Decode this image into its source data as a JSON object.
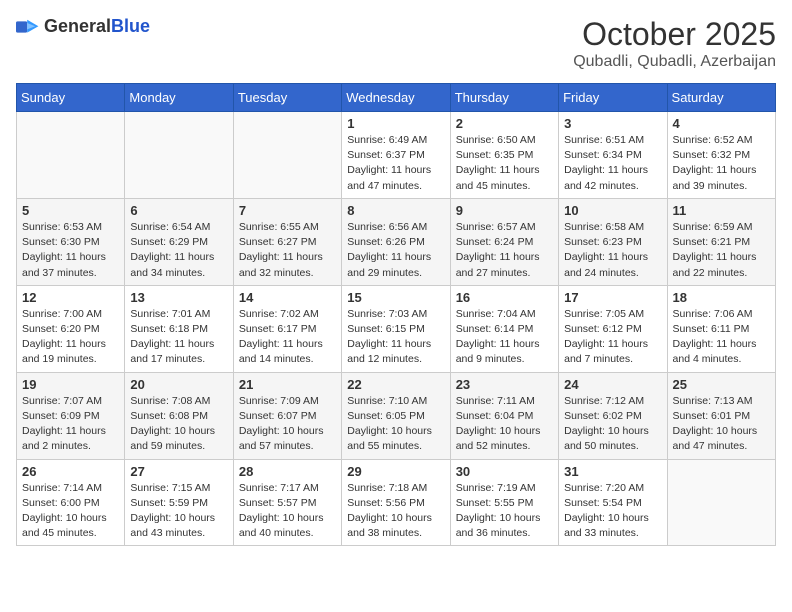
{
  "header": {
    "logo_general": "General",
    "logo_blue": "Blue",
    "month": "October 2025",
    "location": "Qubadli, Qubadli, Azerbaijan"
  },
  "days_of_week": [
    "Sunday",
    "Monday",
    "Tuesday",
    "Wednesday",
    "Thursday",
    "Friday",
    "Saturday"
  ],
  "weeks": [
    [
      {
        "day": "",
        "info": ""
      },
      {
        "day": "",
        "info": ""
      },
      {
        "day": "",
        "info": ""
      },
      {
        "day": "1",
        "info": "Sunrise: 6:49 AM\nSunset: 6:37 PM\nDaylight: 11 hours and 47 minutes."
      },
      {
        "day": "2",
        "info": "Sunrise: 6:50 AM\nSunset: 6:35 PM\nDaylight: 11 hours and 45 minutes."
      },
      {
        "day": "3",
        "info": "Sunrise: 6:51 AM\nSunset: 6:34 PM\nDaylight: 11 hours and 42 minutes."
      },
      {
        "day": "4",
        "info": "Sunrise: 6:52 AM\nSunset: 6:32 PM\nDaylight: 11 hours and 39 minutes."
      }
    ],
    [
      {
        "day": "5",
        "info": "Sunrise: 6:53 AM\nSunset: 6:30 PM\nDaylight: 11 hours and 37 minutes."
      },
      {
        "day": "6",
        "info": "Sunrise: 6:54 AM\nSunset: 6:29 PM\nDaylight: 11 hours and 34 minutes."
      },
      {
        "day": "7",
        "info": "Sunrise: 6:55 AM\nSunset: 6:27 PM\nDaylight: 11 hours and 32 minutes."
      },
      {
        "day": "8",
        "info": "Sunrise: 6:56 AM\nSunset: 6:26 PM\nDaylight: 11 hours and 29 minutes."
      },
      {
        "day": "9",
        "info": "Sunrise: 6:57 AM\nSunset: 6:24 PM\nDaylight: 11 hours and 27 minutes."
      },
      {
        "day": "10",
        "info": "Sunrise: 6:58 AM\nSunset: 6:23 PM\nDaylight: 11 hours and 24 minutes."
      },
      {
        "day": "11",
        "info": "Sunrise: 6:59 AM\nSunset: 6:21 PM\nDaylight: 11 hours and 22 minutes."
      }
    ],
    [
      {
        "day": "12",
        "info": "Sunrise: 7:00 AM\nSunset: 6:20 PM\nDaylight: 11 hours and 19 minutes."
      },
      {
        "day": "13",
        "info": "Sunrise: 7:01 AM\nSunset: 6:18 PM\nDaylight: 11 hours and 17 minutes."
      },
      {
        "day": "14",
        "info": "Sunrise: 7:02 AM\nSunset: 6:17 PM\nDaylight: 11 hours and 14 minutes."
      },
      {
        "day": "15",
        "info": "Sunrise: 7:03 AM\nSunset: 6:15 PM\nDaylight: 11 hours and 12 minutes."
      },
      {
        "day": "16",
        "info": "Sunrise: 7:04 AM\nSunset: 6:14 PM\nDaylight: 11 hours and 9 minutes."
      },
      {
        "day": "17",
        "info": "Sunrise: 7:05 AM\nSunset: 6:12 PM\nDaylight: 11 hours and 7 minutes."
      },
      {
        "day": "18",
        "info": "Sunrise: 7:06 AM\nSunset: 6:11 PM\nDaylight: 11 hours and 4 minutes."
      }
    ],
    [
      {
        "day": "19",
        "info": "Sunrise: 7:07 AM\nSunset: 6:09 PM\nDaylight: 11 hours and 2 minutes."
      },
      {
        "day": "20",
        "info": "Sunrise: 7:08 AM\nSunset: 6:08 PM\nDaylight: 10 hours and 59 minutes."
      },
      {
        "day": "21",
        "info": "Sunrise: 7:09 AM\nSunset: 6:07 PM\nDaylight: 10 hours and 57 minutes."
      },
      {
        "day": "22",
        "info": "Sunrise: 7:10 AM\nSunset: 6:05 PM\nDaylight: 10 hours and 55 minutes."
      },
      {
        "day": "23",
        "info": "Sunrise: 7:11 AM\nSunset: 6:04 PM\nDaylight: 10 hours and 52 minutes."
      },
      {
        "day": "24",
        "info": "Sunrise: 7:12 AM\nSunset: 6:02 PM\nDaylight: 10 hours and 50 minutes."
      },
      {
        "day": "25",
        "info": "Sunrise: 7:13 AM\nSunset: 6:01 PM\nDaylight: 10 hours and 47 minutes."
      }
    ],
    [
      {
        "day": "26",
        "info": "Sunrise: 7:14 AM\nSunset: 6:00 PM\nDaylight: 10 hours and 45 minutes."
      },
      {
        "day": "27",
        "info": "Sunrise: 7:15 AM\nSunset: 5:59 PM\nDaylight: 10 hours and 43 minutes."
      },
      {
        "day": "28",
        "info": "Sunrise: 7:17 AM\nSunset: 5:57 PM\nDaylight: 10 hours and 40 minutes."
      },
      {
        "day": "29",
        "info": "Sunrise: 7:18 AM\nSunset: 5:56 PM\nDaylight: 10 hours and 38 minutes."
      },
      {
        "day": "30",
        "info": "Sunrise: 7:19 AM\nSunset: 5:55 PM\nDaylight: 10 hours and 36 minutes."
      },
      {
        "day": "31",
        "info": "Sunrise: 7:20 AM\nSunset: 5:54 PM\nDaylight: 10 hours and 33 minutes."
      },
      {
        "day": "",
        "info": ""
      }
    ]
  ]
}
